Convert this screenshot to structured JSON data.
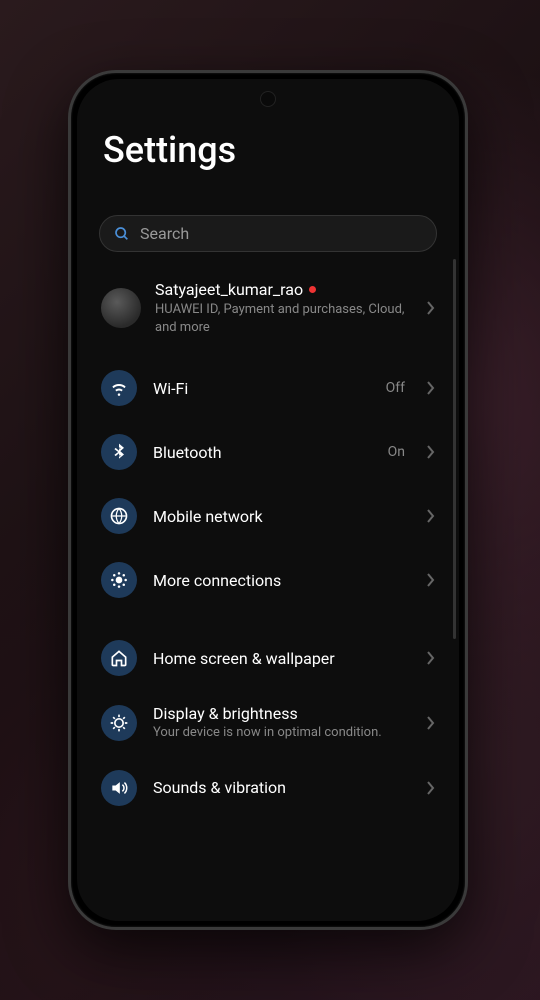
{
  "header": {
    "title": "Settings"
  },
  "search": {
    "placeholder": "Search"
  },
  "account": {
    "name": "Satyajeet_kumar_rao",
    "subtitle": "HUAWEI ID, Payment and purchases, Cloud, and more",
    "has_notification": true
  },
  "groups": [
    {
      "items": [
        {
          "icon": "wifi",
          "label": "Wi-Fi",
          "value": "Off"
        },
        {
          "icon": "bluetooth",
          "label": "Bluetooth",
          "value": "On"
        },
        {
          "icon": "mobile-network",
          "label": "Mobile network",
          "value": ""
        },
        {
          "icon": "more-connections",
          "label": "More connections",
          "value": ""
        }
      ]
    },
    {
      "items": [
        {
          "icon": "home-screen",
          "label": "Home screen & wallpaper",
          "value": ""
        },
        {
          "icon": "display",
          "label": "Display & brightness",
          "value": "",
          "subtitle": "Your device is now in optimal condition."
        },
        {
          "icon": "sounds",
          "label": "Sounds & vibration",
          "value": ""
        }
      ]
    }
  ]
}
